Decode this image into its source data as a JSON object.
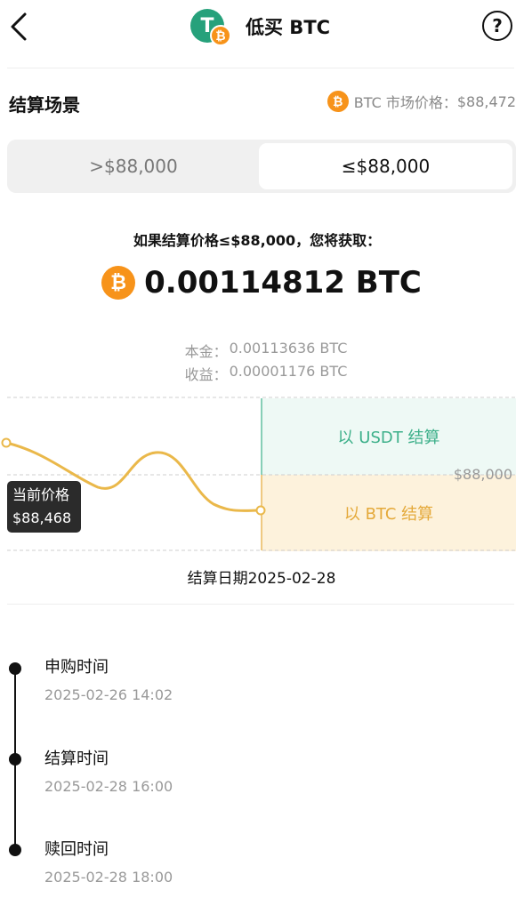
{
  "header": {
    "title": "低买 BTC",
    "usdt_logo_glyph": "T",
    "btc_logo_glyph": "₿",
    "help_glyph": "?"
  },
  "scenario": {
    "title": "结算场景",
    "market_price_label": "BTC 市场价格：",
    "market_price_value": "$88,472",
    "options": [
      ">$88,000",
      "≤$88,000"
    ],
    "selected_index": 1
  },
  "result": {
    "headline": "如果结算价格≤$88,000，您将获取：",
    "amount": "0.00114812 BTC",
    "principal_label": "本金：",
    "principal_value": "0.00113636 BTC",
    "yield_label": "收益：",
    "yield_value": "0.00001176 BTC"
  },
  "chart": {
    "zone_upper_label": "以 USDT 结算",
    "zone_lower_label": "以 BTC 结算",
    "strike_label": "$88,000",
    "current_label": "当前价格",
    "current_value": "$88,468",
    "settlement_date": "结算日期2025-02-28",
    "colors": {
      "line": "#eab84a",
      "usdt_zone": "#eef9f5",
      "btc_zone": "#fdf2dc",
      "usdt_text": "#3db08a",
      "btc_text": "#e4a93a"
    }
  },
  "timeline": [
    {
      "title": "申购时间",
      "time": "2025-02-26 14:02"
    },
    {
      "title": "结算时间",
      "time": "2025-02-28 16:00"
    },
    {
      "title": "赎回时间",
      "time": "2025-02-28 18:00"
    }
  ]
}
